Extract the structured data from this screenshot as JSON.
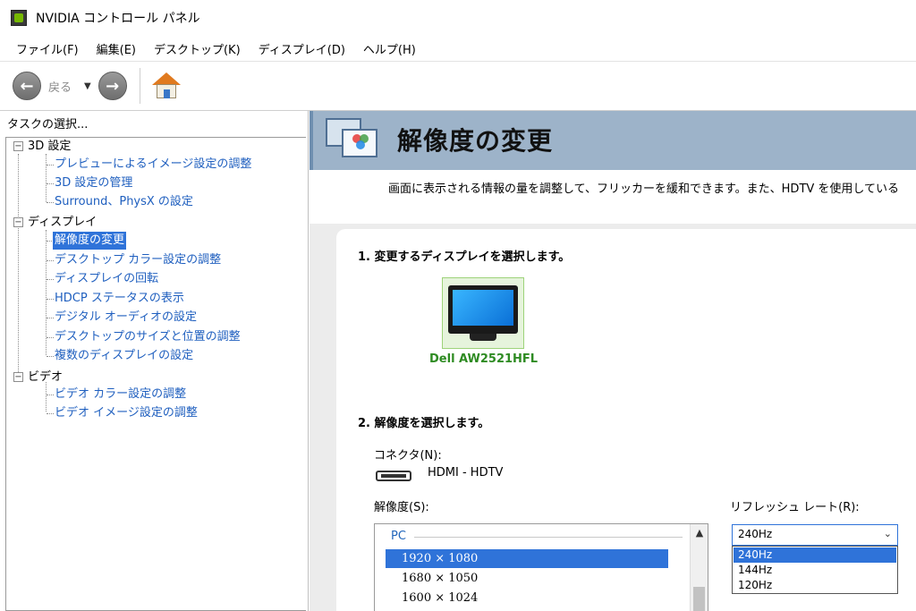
{
  "window": {
    "title": "NVIDIA コントロール パネル"
  },
  "menu": [
    "ファイル(F)",
    "編集(E)",
    "デスクトップ(K)",
    "ディスプレイ(D)",
    "ヘルプ(H)"
  ],
  "toolbar": {
    "back_label": "戻る",
    "back_icon": "arrow-left-icon",
    "forward_icon": "arrow-right-icon",
    "home_icon": "home-icon"
  },
  "sidebar": {
    "header": "タスクの選択...",
    "categories": [
      {
        "label": "3D 設定",
        "items": [
          "プレビューによるイメージ設定の調整",
          "3D 設定の管理",
          "Surround、PhysX の設定"
        ]
      },
      {
        "label": "ディスプレイ",
        "items": [
          "解像度の変更",
          "デスクトップ カラー設定の調整",
          "ディスプレイの回転",
          "HDCP ステータスの表示",
          "デジタル オーディオの設定",
          "デスクトップのサイズと位置の調整",
          "複数のディスプレイの設定"
        ]
      },
      {
        "label": "ビデオ",
        "items": [
          "ビデオ カラー設定の調整",
          "ビデオ イメージ設定の調整"
        ]
      }
    ],
    "selected": "解像度の変更"
  },
  "main": {
    "title": "解像度の変更",
    "description": "画面に表示される情報の量を調整して、フリッカーを緩和できます。また、HDTV を使用している",
    "step1": "1. 変更するディスプレイを選択します。",
    "display_name": "Dell AW2521HFL",
    "step2": "2. 解像度を選択します。",
    "connector_label": "コネクタ(N):",
    "connector_value": "HDMI - HDTV",
    "resolution_label": "解像度(S):",
    "resolution_group": "PC",
    "resolutions": [
      "1920 × 1080",
      "1680 × 1050",
      "1600 × 1024"
    ],
    "selected_resolution": "1920 × 1080",
    "refresh_label": "リフレッシュ レート(R):",
    "refresh_value": "240Hz",
    "refresh_options": [
      "240Hz",
      "144Hz",
      "120Hz"
    ]
  },
  "colors": {
    "accent": "#2f73d9",
    "header_bg": "#9db3c9",
    "display_green": "#2e8b22"
  }
}
